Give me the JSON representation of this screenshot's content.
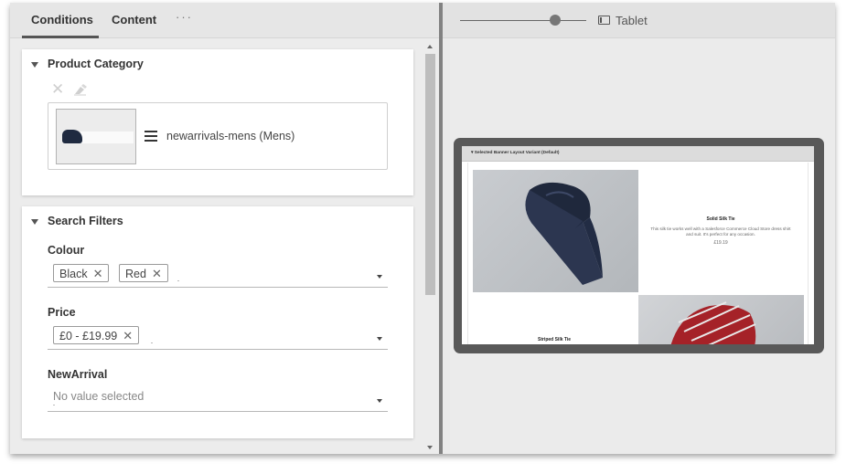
{
  "tabs": {
    "conditions": "Conditions",
    "content": "Content",
    "more": "···"
  },
  "product_category": {
    "title": "Product Category",
    "item_label": "newarrivals-mens (Mens)"
  },
  "search_filters": {
    "title": "Search Filters",
    "colour": {
      "label": "Colour",
      "chips": [
        "Black",
        "Red"
      ]
    },
    "price": {
      "label": "Price",
      "chips": [
        "£0 - £19.99"
      ]
    },
    "new_arrival": {
      "label": "NewArrival",
      "placeholder": "No value selected"
    }
  },
  "preview": {
    "slider": {
      "level": 0.75
    },
    "device_label": "Tablet",
    "screen_header": "Selected Banner Layout Variant (Default)",
    "products": [
      {
        "name": "Solid Silk Tie",
        "description": "This silk tie works well with a Salesforce Commerce Cloud Store dress shirt and suit. It's perfect for any occasion.",
        "price": "£19.19"
      },
      {
        "name": "Striped Silk Tie"
      }
    ]
  },
  "icons": {
    "collapse": "caret-down-icon",
    "remove": "close-icon",
    "clear": "eraser-icon",
    "drag": "hamburger-icon",
    "dropdown": "dropdown-arrow-icon",
    "device": "tablet-icon"
  },
  "colors": {
    "panel_bg": "#ebebeb",
    "card_bg": "#ffffff",
    "device_frame": "#595959",
    "tie_navy": "#2c3650",
    "tie_red": "#a52228"
  }
}
